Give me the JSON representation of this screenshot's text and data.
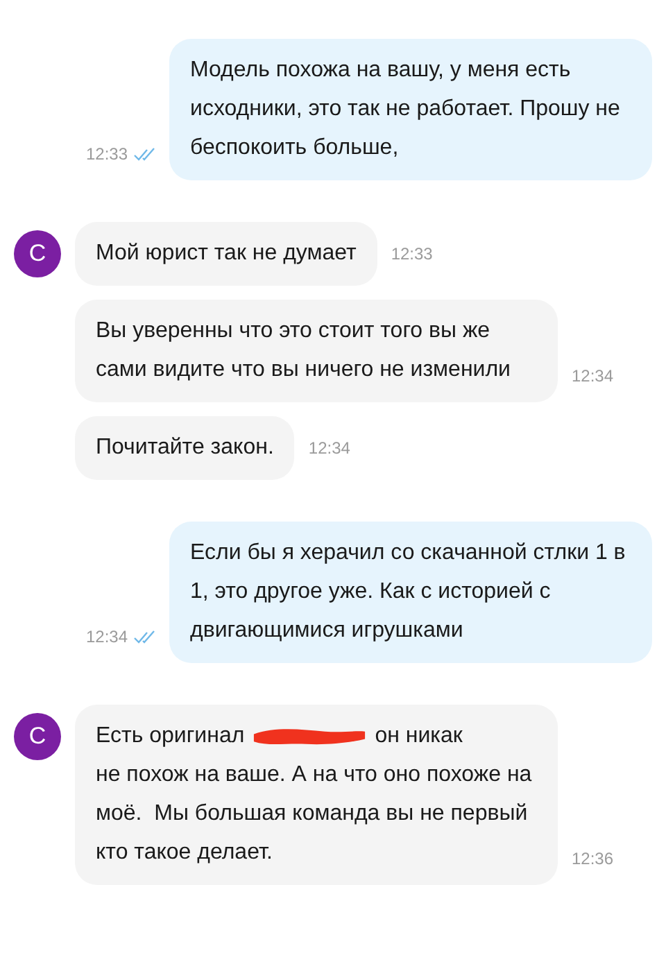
{
  "messages": [
    {
      "kind": "outgoing",
      "text": "Модель похожа на вашу, у меня есть исходники, это так не работает. Прошу не беспокоить больше,",
      "time": "12:33",
      "read": true
    },
    {
      "kind": "incoming",
      "avatar": "С",
      "text": "Мой юрист так не думает",
      "time": "12:33"
    },
    {
      "kind": "incoming",
      "text": "Вы уверенны что это стоит того вы же сами видите что вы ничего не изменили",
      "time": "12:34"
    },
    {
      "kind": "incoming",
      "text": "Почитайте закон.",
      "time": "12:34"
    },
    {
      "kind": "outgoing",
      "text": "Если бы я херачил со скачанной стлки 1 в 1, это другое уже. Как с историей с двигающимися игрушками",
      "time": "12:34",
      "read": true
    },
    {
      "kind": "redacted",
      "avatar": "С",
      "text_before": "Есть оригинал",
      "text_after": "он никак",
      "text_rest": "не похож на ваше. А на что оно похоже на моё.  Мы большая команда вы не первый кто такое делает.",
      "time": "12:36"
    }
  ]
}
